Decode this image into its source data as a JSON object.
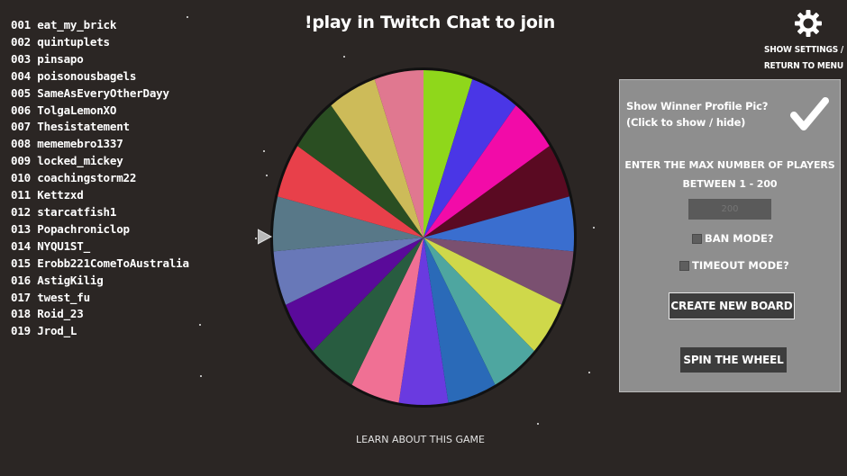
{
  "title": "!play in Twitch Chat to join",
  "players": [
    "001 eat_my_brick",
    "002 quintuplets",
    "003 pinsapo",
    "004 poisonousbagels",
    "005 SameAsEveryOtherDayy",
    "006 TolgaLemonXO",
    "007 Thesistatement",
    "008 mememebro1337",
    "009 locked_mickey",
    "010 coachingstorm22",
    "011 Kettzxd",
    "012 starcatfish1",
    "013 Popachroniclop",
    "014 NYQU1ST_",
    "015 Erobb221ComeToAustralia",
    "016 AstigKilig",
    "017 twest_fu",
    "018 Roid_23",
    "019 Jrod_L"
  ],
  "settings": {
    "icon": "gear-icon",
    "link_line1": "SHOW SETTINGS /",
    "link_line2": "RETURN TO MENU"
  },
  "panel": {
    "winner_line1": "Show Winner Profile Pic?",
    "winner_line2": "(Click to show / hide)",
    "winner_checked": true,
    "max_line1": "ENTER THE MAX NUMBER OF PLAYERS",
    "max_line2": "BETWEEN 1 - 200",
    "max_placeholder": "200",
    "ban_mode": "BAN MODE?",
    "timeout_mode": "TIMEOUT MODE?",
    "create_button": "CREATE NEW BOARD",
    "spin_button": "SPIN THE WHEEL"
  },
  "wheel": {
    "segment_count": 19,
    "colors": [
      "#8fd71b",
      "#4a36e6",
      "#f20ba8",
      "#5a0a22",
      "#3a6ecf",
      "#7a5070",
      "#cfd84a",
      "#4ea6a0",
      "#2a6ab8",
      "#6a3ae0",
      "#f07094",
      "#285c40",
      "#5a0a9a",
      "#6878b8",
      "#587888",
      "#e8404a",
      "#2a4e22",
      "#cdbb59",
      "#e07890"
    ]
  },
  "learn_link": "LEARN ABOUT THIS GAME"
}
